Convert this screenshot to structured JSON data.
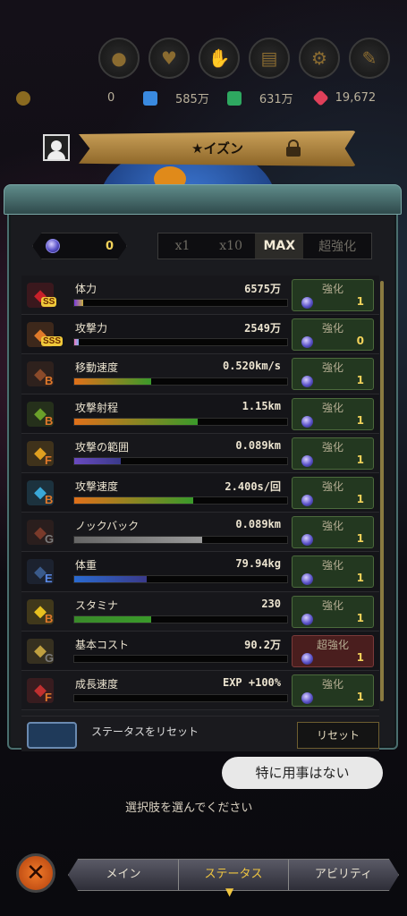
{
  "top_buttons": [
    "coin-icon",
    "trophy-icon",
    "gift-icon",
    "book-icon",
    "gear-icon",
    "wrench-icon"
  ],
  "currencies": {
    "gold": "0",
    "blue_gem": "585万",
    "green_gem": "631万",
    "red_gem": "19,672"
  },
  "character": {
    "title": "★イズン"
  },
  "panel": {
    "coin_value": "0",
    "multiplier_tabs": [
      {
        "label": "x1",
        "active": false
      },
      {
        "label": "x10",
        "active": false
      },
      {
        "label": "MAX",
        "active": true
      },
      {
        "label": "超強化",
        "active": false
      }
    ]
  },
  "stats": [
    {
      "name": "体力",
      "value": "6575万",
      "rank": "SS",
      "upgrade_label": "強化",
      "cost": "1",
      "fill": 0.04,
      "icon": "heart-icon"
    },
    {
      "name": "攻撃力",
      "value": "2549万",
      "rank": "SSS",
      "upgrade_label": "強化",
      "cost": "0",
      "fill": 0.02,
      "icon": "sword-icon"
    },
    {
      "name": "移動速度",
      "value": "0.520km/s",
      "rank": "B",
      "upgrade_label": "強化",
      "cost": "1",
      "fill": 0.36,
      "icon": "boot-icon"
    },
    {
      "name": "攻撃射程",
      "value": "1.15km",
      "rank": "B",
      "upgrade_label": "強化",
      "cost": "1",
      "fill": 0.58,
      "icon": "bow-icon"
    },
    {
      "name": "攻撃の範囲",
      "value": "0.089km",
      "rank": "F",
      "upgrade_label": "強化",
      "cost": "1",
      "fill": 0.22,
      "icon": "spark-icon"
    },
    {
      "name": "攻撃速度",
      "value": "2.400s/回",
      "rank": "B",
      "upgrade_label": "強化",
      "cost": "1",
      "fill": 0.56,
      "icon": "wind-icon"
    },
    {
      "name": "ノックバック",
      "value": "0.089km",
      "rank": "G",
      "upgrade_label": "強化",
      "cost": "1",
      "fill": 0.6,
      "icon": "fist-icon"
    },
    {
      "name": "体重",
      "value": "79.94kg",
      "rank": "E",
      "upgrade_label": "強化",
      "cost": "1",
      "fill": 0.34,
      "icon": "weight-icon"
    },
    {
      "name": "スタミナ",
      "value": "230",
      "rank": "B",
      "upgrade_label": "強化",
      "cost": "1",
      "fill": 0.36,
      "icon": "heart-gold-icon"
    },
    {
      "name": "基本コスト",
      "value": "90.2万",
      "rank": "G",
      "upgrade_label": "超強化",
      "cost": "1",
      "fill": 0.0,
      "icon": "hammer-icon"
    },
    {
      "name": "成長速度",
      "value": "EXP +100%",
      "rank": "F",
      "upgrade_label": "強化",
      "cost": "1",
      "fill": 0.0,
      "icon": "chart-icon"
    }
  ],
  "reset": {
    "text": "ステータスをリセット",
    "button": "リセット"
  },
  "speech_bubble": "特に用事はない",
  "hint": "選択肢を選んでください",
  "bottom_nav": [
    {
      "label": "メイン",
      "active": false
    },
    {
      "label": "ステータス",
      "active": true
    },
    {
      "label": "アビリティ",
      "active": false
    }
  ]
}
